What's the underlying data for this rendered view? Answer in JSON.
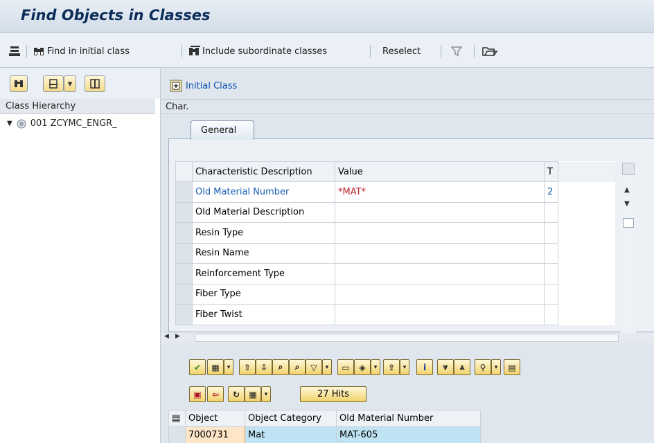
{
  "window": {
    "title": "Find Objects in Classes"
  },
  "toolbar": {
    "find_initial_label": "Find in initial class",
    "include_sub_label": "Include subordinate classes",
    "reselect_label": "Reselect"
  },
  "left": {
    "header": "Class Hierarchy",
    "node_label": "001 ZCYMC_ENGR_"
  },
  "right": {
    "initial_class_label": "Initial Class",
    "char_label": "Char.",
    "tab_general": "General",
    "columns": {
      "desc": "Characteristic Description",
      "value": "Value",
      "t": "T"
    },
    "rows": [
      {
        "desc": "Old Material Number",
        "value": "*MAT*",
        "t": "2"
      },
      {
        "desc": "Old Material Description",
        "value": "",
        "t": ""
      },
      {
        "desc": "Resin Type",
        "value": "",
        "t": ""
      },
      {
        "desc": "Resin Name",
        "value": "",
        "t": ""
      },
      {
        "desc": "Reinforcement Type",
        "value": "",
        "t": ""
      },
      {
        "desc": "Fiber Type",
        "value": "",
        "t": ""
      },
      {
        "desc": "Fiber Twist",
        "value": "",
        "t": ""
      }
    ],
    "hits_label": "27 Hits",
    "result_columns": {
      "object": "Object",
      "category": "Object Category",
      "old_number": "Old Material Number"
    },
    "result_rows": [
      {
        "object": "7000731",
        "category": "Mat",
        "old_number": "MAT-605"
      }
    ]
  },
  "colors": {
    "accent": "#0a4fb0",
    "value_red": "#c0202a",
    "title": "#0c2d5a"
  }
}
